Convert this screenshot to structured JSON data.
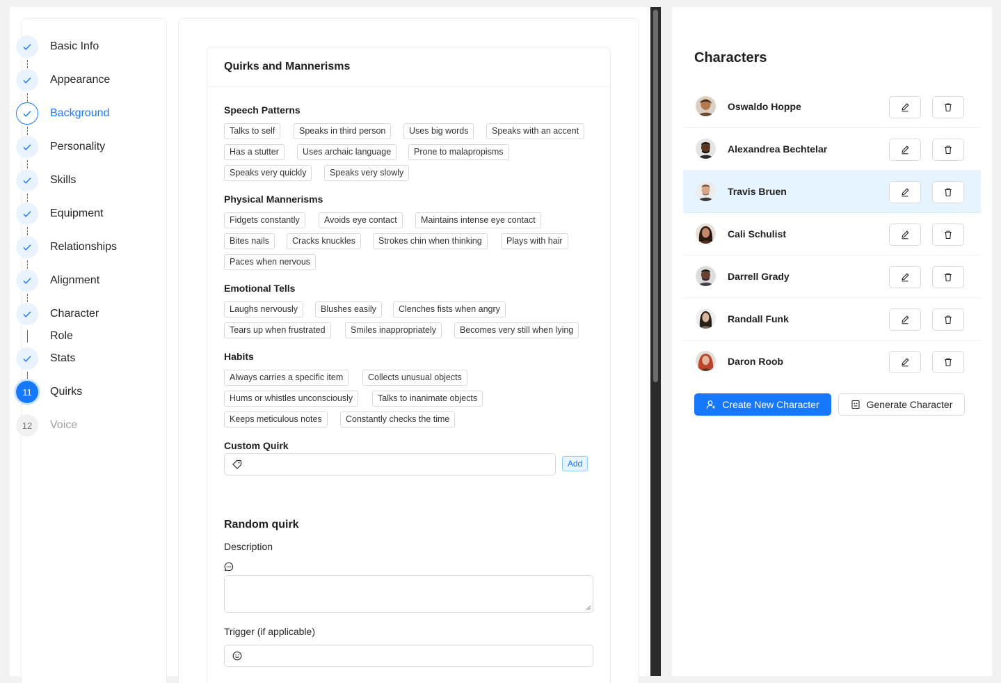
{
  "stepper": {
    "steps": [
      {
        "label": "Basic Info",
        "state": "done"
      },
      {
        "label": "Appearance",
        "state": "done"
      },
      {
        "label": "Background",
        "state": "active"
      },
      {
        "label": "Personality",
        "state": "done"
      },
      {
        "label": "Skills",
        "state": "done"
      },
      {
        "label": "Equipment",
        "state": "done"
      },
      {
        "label": "Relationships",
        "state": "done"
      },
      {
        "label": "Alignment",
        "state": "done"
      },
      {
        "label": "Character",
        "sublabel": "Role",
        "state": "done"
      },
      {
        "label": "Stats",
        "state": "done"
      },
      {
        "label": "Quirks",
        "number": "11",
        "state": "current"
      },
      {
        "label": "Voice",
        "number": "12",
        "state": "pending"
      }
    ]
  },
  "quirks": {
    "card_title": "Quirks and Mannerisms",
    "sections": [
      {
        "title": "Speech Patterns",
        "tags": [
          "Talks to self",
          "Speaks in third person",
          "Uses big words",
          "Speaks with an accent",
          "Has a stutter",
          "Uses archaic language",
          "Prone to malapropisms",
          "Speaks very quickly",
          "Speaks very slowly"
        ]
      },
      {
        "title": "Physical Mannerisms",
        "tags": [
          "Fidgets constantly",
          "Avoids eye contact",
          "Maintains intense eye contact",
          "Bites nails",
          "Cracks knuckles",
          "Strokes chin when thinking",
          "Plays with hair",
          "Paces when nervous"
        ]
      },
      {
        "title": "Emotional Tells",
        "tags": [
          "Laughs nervously",
          "Blushes easily",
          "Clenches fists when angry",
          "Tears up when frustrated",
          "Smiles inappropriately",
          "Becomes very still when lying"
        ]
      },
      {
        "title": "Habits",
        "tags": [
          "Always carries a specific item",
          "Collects unusual objects",
          "Hums or whistles unconsciously",
          "Talks to inanimate objects",
          "Keeps meticulous notes",
          "Constantly checks the time"
        ]
      }
    ],
    "custom_label": "Custom Quirk",
    "custom_value": "",
    "add_label": "Add",
    "random_title": "Random quirk",
    "description_label": "Description",
    "description_value": "",
    "trigger_label": "Trigger (if applicable)",
    "trigger_value": ""
  },
  "characters": {
    "title": "Characters",
    "list": [
      {
        "name": "Oswaldo Hoppe",
        "selected": false
      },
      {
        "name": "Alexandrea Bechtelar",
        "selected": false
      },
      {
        "name": "Travis Bruen",
        "selected": true
      },
      {
        "name": "Cali Schulist",
        "selected": false
      },
      {
        "name": "Darrell Grady",
        "selected": false
      },
      {
        "name": "Randall Funk",
        "selected": false
      },
      {
        "name": "Daron Roob",
        "selected": false
      }
    ],
    "create_label": "Create New Character",
    "generate_label": "Generate Character",
    "icons": {
      "edit": "edit-icon",
      "delete": "delete-icon",
      "create": "user-add-icon",
      "generate": "robot-icon"
    }
  },
  "colors": {
    "accent": "#1677ff",
    "selected_row": "#e6f4ff"
  }
}
